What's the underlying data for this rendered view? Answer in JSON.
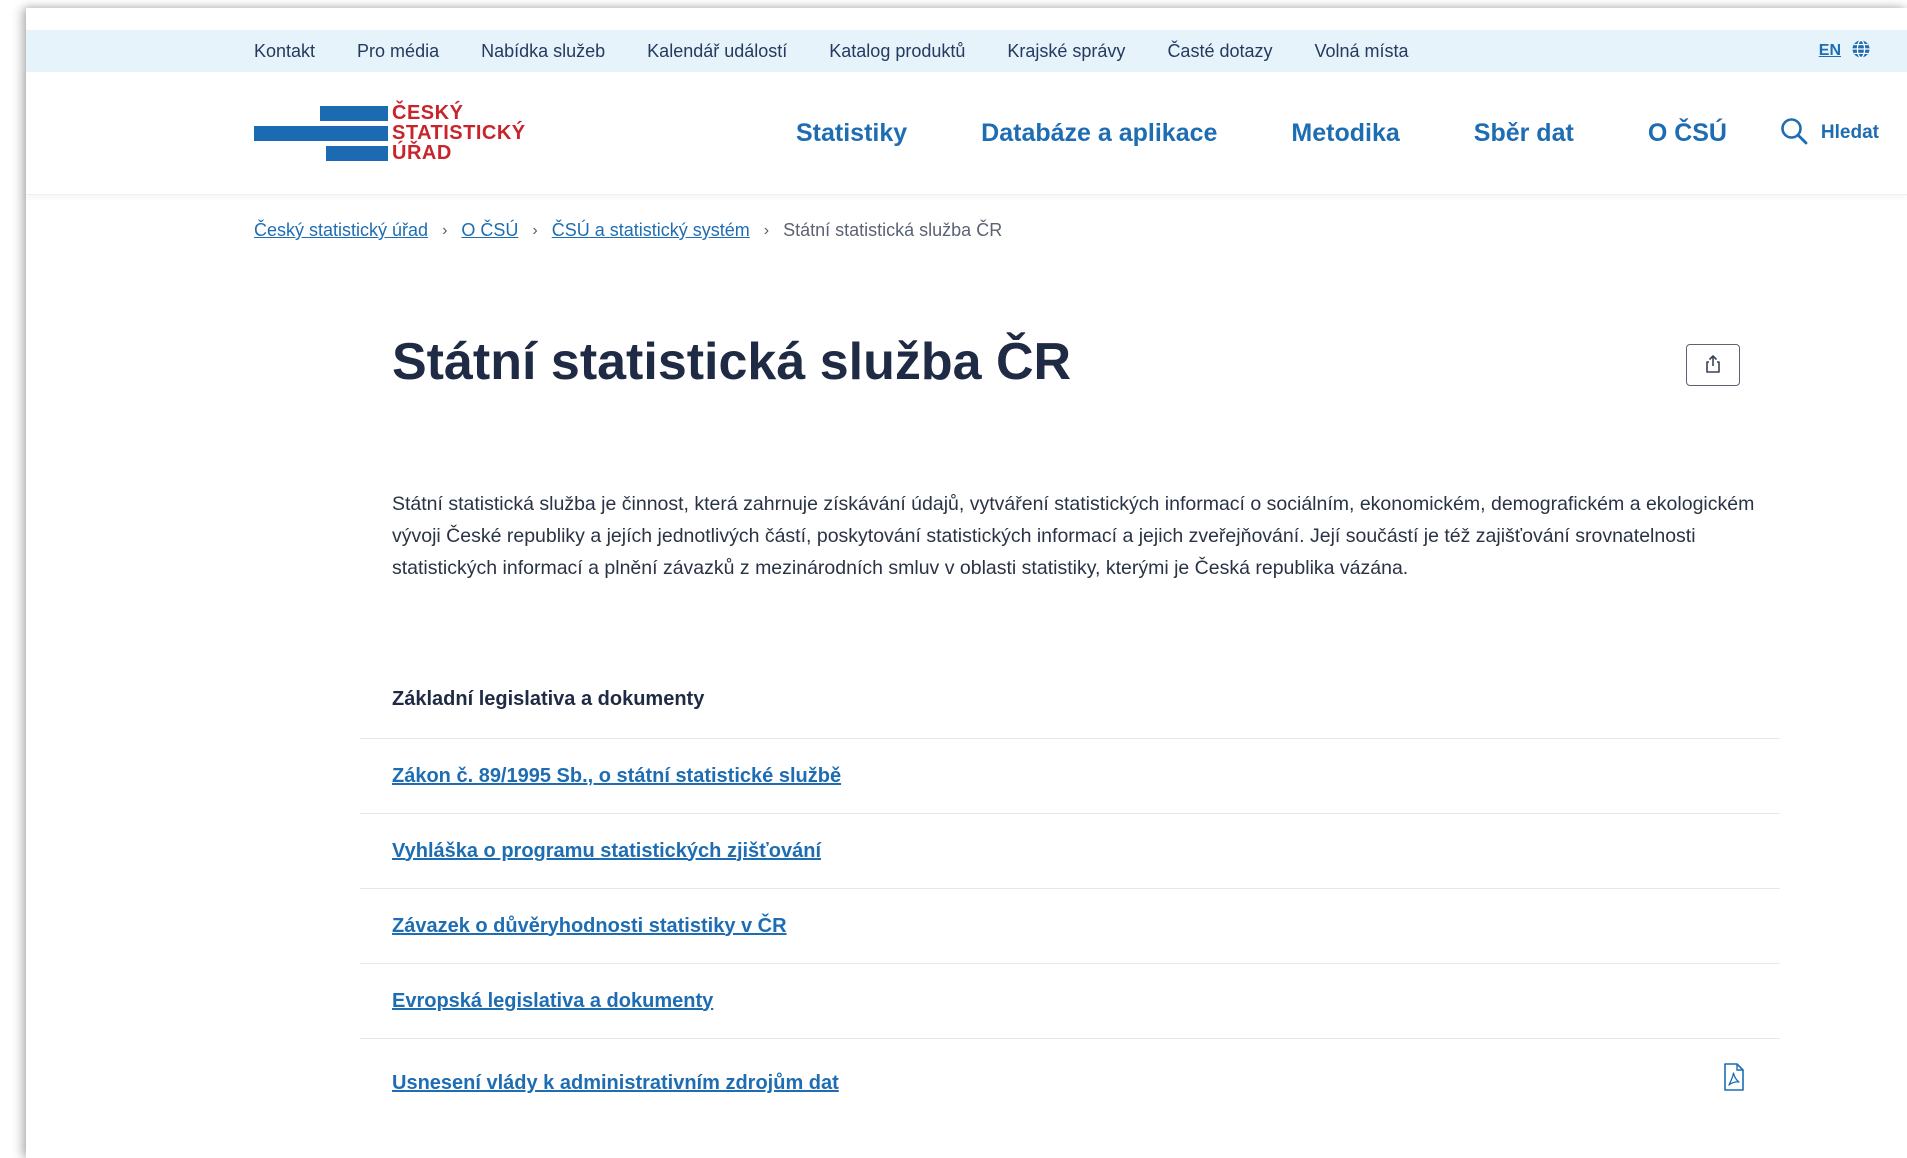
{
  "utility_nav": {
    "links": [
      "Kontakt",
      "Pro média",
      "Nabídka služeb",
      "Kalendář událostí",
      "Katalog produktů",
      "Krajské správy",
      "Časté dotazy",
      "Volná místa"
    ],
    "language": "EN",
    "language_icon": "globe-icon"
  },
  "logo": {
    "line1": "ČESKÝ",
    "line2": "STATISTICKÝ",
    "line3": "ÚŘAD"
  },
  "main_nav": {
    "items": [
      "Statistiky",
      "Databáze a aplikace",
      "Metodika",
      "Sběr dat",
      "O ČSÚ"
    ],
    "search_label": "Hledat",
    "search_icon": "search-icon"
  },
  "breadcrumb": {
    "items": [
      "Český statistický úřad",
      "O ČSÚ",
      "ČSÚ a statistický systém"
    ],
    "current": "Státní statistická služba ČR"
  },
  "page": {
    "title": "Státní statistická služba ČR",
    "share_icon": "share-icon",
    "intro": "Státní statistická služba je činnost, která zahrnuje získávání údajů, vytváření statistických informací o sociálním, ekonomickém, demografickém a ekologickém vývoji České republiky a jejích jednotlivých částí, poskytování statistických informací a jejich zveřejňování. Její součástí je též zajišťování srovnatelnosti statistických informací a plnění závazků z mezinárodních smluv v oblasti statistiky, kterými je Česká republika vázána.",
    "section_title": "Základní legislativa a dokumenty",
    "documents": [
      "Zákon č. 89/1995 Sb., o státní statistické službě",
      "Vyhláška o programu statistických zjišťování",
      "Závazek o důvěryhodnosti statistiky v ČR",
      "Evropská legislativa a dokumenty",
      "Usnesení vlády k administrativním zdrojům dat"
    ],
    "pdf_icon": "pdf-icon"
  },
  "colors": {
    "brand_blue": "#1c6ab2",
    "brand_red": "#c8242b",
    "link_blue": "#1e6db3",
    "utility_bg": "#e6f3fb",
    "heading": "#1f2a44"
  }
}
